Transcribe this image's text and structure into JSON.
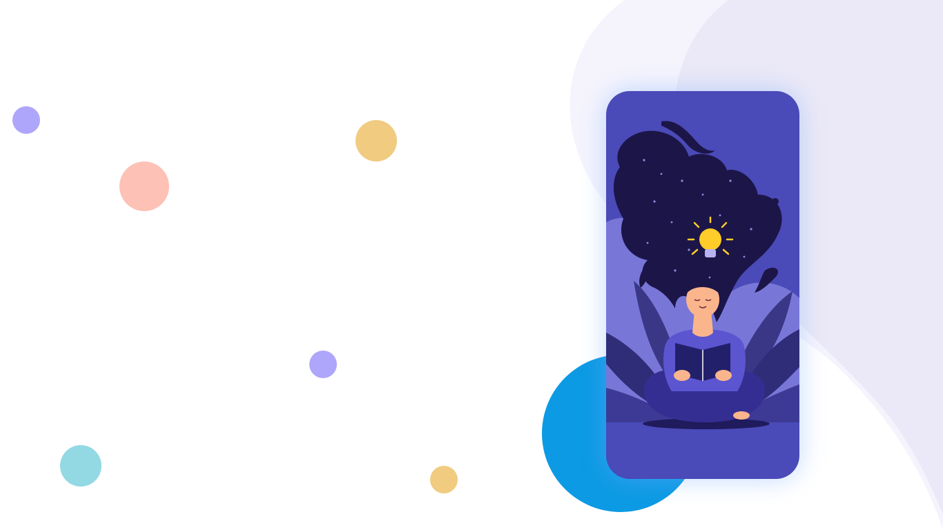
{
  "colors": {
    "background": "#ffffff",
    "wave_light": "#f5f4fd",
    "wave_mid": "#ebe9f7",
    "dot_purple": "#aea6fb",
    "dot_pink": "#fdc1b6",
    "dot_yellow": "#f0cb80",
    "dot_teal": "#93d9e4",
    "big_circle": "#0c9ae4",
    "card_bg": "#4a4ab8",
    "hair": "#1c1548",
    "leaf_light": "#8c8ae6",
    "leaf_dark": "#2f2d78",
    "bulb": "#ffcd29",
    "skin": "#fbb58c",
    "shirt": "#5b55d0",
    "pants": "#352e92"
  },
  "decor": {
    "dots": [
      {
        "name": "purple-dot",
        "color": "#aea6fb"
      },
      {
        "name": "pink-dot",
        "color": "#fdc1b6"
      },
      {
        "name": "yellow-dot",
        "color": "#f0cb80"
      },
      {
        "name": "purple-dot",
        "color": "#aea6fb"
      },
      {
        "name": "teal-dot",
        "color": "#93d9e4"
      },
      {
        "name": "yellow-dot",
        "color": "#f0cb80"
      }
    ]
  },
  "illustration": {
    "icon": "reading-woman-lightbulb-illustration",
    "elements": [
      "hair-with-stars",
      "lightbulb-icon",
      "woman-reading-book",
      "leaves"
    ]
  }
}
